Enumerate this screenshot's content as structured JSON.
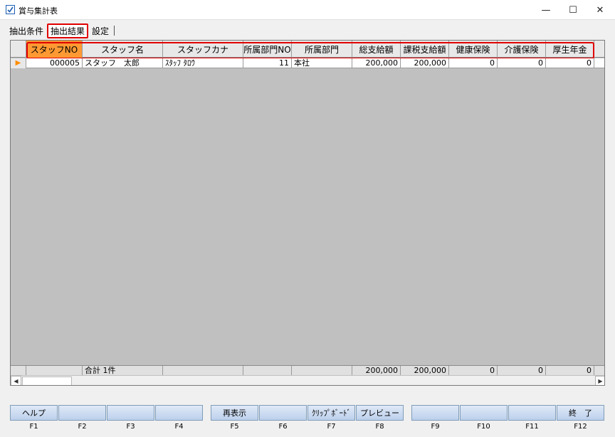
{
  "window": {
    "title": "賞与集計表",
    "minimize": "—",
    "maximize": "☐",
    "close": "✕",
    "accent_color": "#e00000",
    "highlight_color": "#ff9933"
  },
  "tabs": [
    {
      "label": "抽出条件"
    },
    {
      "label": "抽出結果"
    },
    {
      "label": "設定"
    }
  ],
  "grid": {
    "columns": [
      "スタッフNO",
      "スタッフ名",
      "スタッフカナ",
      "所属部門NO",
      "所属部門",
      "総支給額",
      "課税支給額",
      "健康保険",
      "介護保険",
      "厚生年金"
    ],
    "rows": [
      {
        "staff_no": "000005",
        "staff_name": "スタッフ　太郎",
        "staff_kana": "ｽﾀｯﾌ ﾀﾛｳ",
        "dept_no": "11",
        "dept": "本社",
        "total_pay": "200,000",
        "taxable_pay": "200,000",
        "health_ins": "0",
        "care_ins": "0",
        "pension": "0"
      }
    ],
    "totals": {
      "label": "合計 1件",
      "total_pay": "200,000",
      "taxable_pay": "200,000",
      "health_ins": "0",
      "care_ins": "0",
      "pension": "0"
    }
  },
  "function_keys": [
    {
      "label": "ヘルプ",
      "key": "F1"
    },
    {
      "label": "",
      "key": "F2"
    },
    {
      "label": "",
      "key": "F3"
    },
    {
      "label": "",
      "key": "F4"
    },
    {
      "label": "再表示",
      "key": "F5"
    },
    {
      "label": "",
      "key": "F6"
    },
    {
      "label": "ｸﾘｯﾌﾟﾎﾞｰﾄﾞ",
      "key": "F7"
    },
    {
      "label": "プレビュー",
      "key": "F8"
    },
    {
      "label": "",
      "key": "F9"
    },
    {
      "label": "",
      "key": "F10"
    },
    {
      "label": "",
      "key": "F11"
    },
    {
      "label": "終　了",
      "key": "F12"
    }
  ]
}
